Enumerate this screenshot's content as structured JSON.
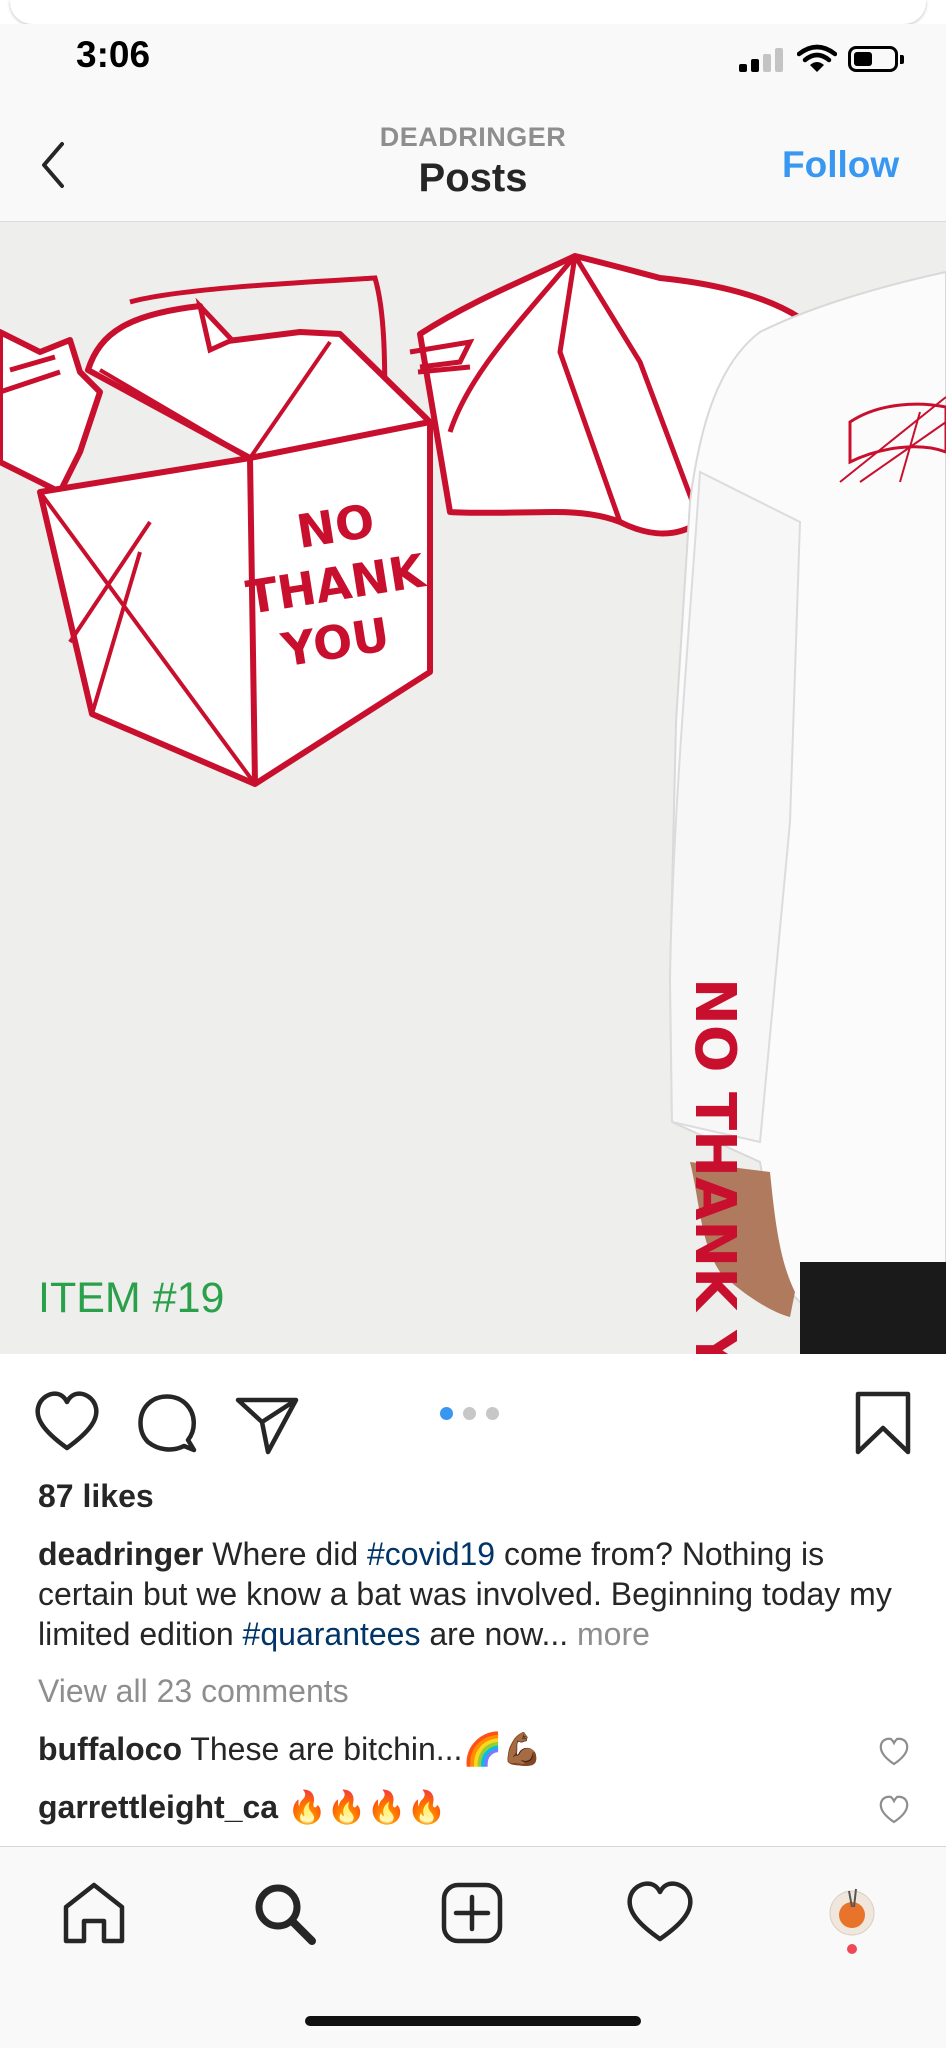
{
  "status_bar": {
    "time": "3:06"
  },
  "nav": {
    "subtitle": "DEADRINGER",
    "title": "Posts",
    "follow_label": "Follow"
  },
  "post": {
    "image_text": {
      "item_label": "ITEM #19",
      "box_text": [
        "NO",
        "THANK",
        "YOU"
      ]
    },
    "carousel": {
      "count": 3,
      "active_index": 0
    },
    "likes": "87 likes",
    "caption": {
      "user": "deadringer",
      "text_1": " Where did ",
      "tag_1": "#covid19",
      "text_2": " come from? Nothing is certain but we know a bat was involved. Beginning today my limited edition ",
      "tag_2": "#quarantees",
      "text_3": " are now...",
      "more": " more"
    },
    "view_comments": "View all 23 comments",
    "comments": [
      {
        "user": "buffaloco",
        "text": "These are bitchin...🌈💪🏾"
      },
      {
        "user": "garrettleight_ca",
        "text": "🔥🔥🔥🔥"
      }
    ]
  },
  "icons": {
    "status": [
      "signal-icon",
      "wifi-icon",
      "battery-icon"
    ],
    "nav": [
      "back-icon"
    ],
    "actions": [
      "heart-icon",
      "comment-icon",
      "share-icon",
      "bookmark-icon"
    ],
    "tabs": [
      "home-icon",
      "search-icon",
      "add-post-icon",
      "activity-heart-icon",
      "profile-avatar"
    ]
  },
  "colors": {
    "accent": "#3897f0",
    "hashtag": "#003569",
    "item_label": "#2aa04a",
    "print_red": "#c8102e",
    "secondary_text": "#8e8e8e",
    "carousel_active": "#3897f0",
    "carousel_inactive": "#c7c7c7",
    "notification": "#ed4956"
  }
}
